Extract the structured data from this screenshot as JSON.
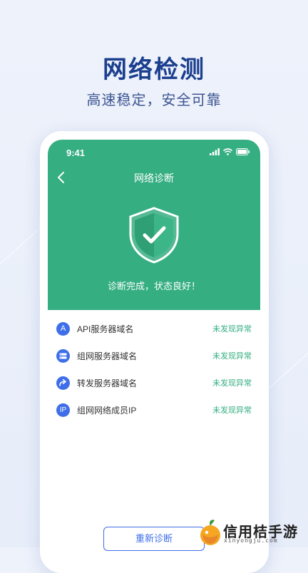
{
  "promo": {
    "headline": "网络检测",
    "subline": "高速稳定，安全可靠"
  },
  "status_bar": {
    "time": "9:41"
  },
  "nav": {
    "title": "网络诊断"
  },
  "result": {
    "message": "诊断完成，状态良好！"
  },
  "checks": [
    {
      "icon_text": "A",
      "icon": "api-icon",
      "name": "API服务器域名",
      "status": "未发现异常"
    },
    {
      "icon_text": "",
      "icon": "server-icon",
      "name": "组网服务器域名",
      "status": "未发现异常"
    },
    {
      "icon_text": "",
      "icon": "forward-icon",
      "name": "转发服务器域名",
      "status": "未发现异常"
    },
    {
      "icon_text": "IP",
      "icon": "ip-icon",
      "name": "组网网络成员IP",
      "status": "未发现异常"
    }
  ],
  "actions": {
    "rediagnose": "重新诊断"
  },
  "watermark": {
    "title": "信用桔手游",
    "subtitle": "xinyongju.com"
  },
  "colors": {
    "brand_green": "#35ae82",
    "accent_blue": "#3e6ee8",
    "headline_blue": "#1b3f8f"
  }
}
